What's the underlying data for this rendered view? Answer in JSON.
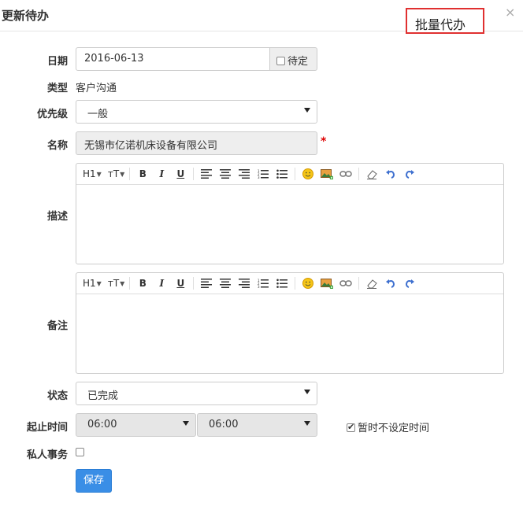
{
  "dialog": {
    "title": "更新待办",
    "batch_button": "批量代办",
    "close": "×"
  },
  "form": {
    "date": {
      "label": "日期",
      "value": "2016-06-13",
      "pending_label": "待定",
      "pending_checked": false
    },
    "type": {
      "label": "类型",
      "value": "客户沟通"
    },
    "priority": {
      "label": "优先级",
      "value": "一般"
    },
    "name": {
      "label": "名称",
      "value": "无锡市亿诺机床设备有限公司",
      "required_mark": "*"
    },
    "description": {
      "label": "描述",
      "value": ""
    },
    "remark": {
      "label": "备注",
      "value": ""
    },
    "status": {
      "label": "状态",
      "value": "已完成"
    },
    "time": {
      "label": "起止时间",
      "start": "06:00",
      "end": "06:00",
      "no_time_label": "暂时不设定时间",
      "no_time_checked": true
    },
    "private": {
      "label": "私人事务",
      "checked": false
    }
  },
  "editor_toolbar": {
    "heading": "H1",
    "font_size": "тT",
    "bold": "B",
    "italic": "I",
    "underline": "U",
    "icons": [
      "align-left-icon",
      "align-center-icon",
      "align-right-icon",
      "ordered-list-icon",
      "unordered-list-icon",
      "emoji-icon",
      "image-icon",
      "link-icon",
      "eraser-icon",
      "undo-icon",
      "redo-icon"
    ]
  },
  "actions": {
    "save": "保存"
  },
  "colors": {
    "save_button": "#3a8ee6",
    "highlight_border": "#e03030",
    "required": "#dd0000"
  }
}
